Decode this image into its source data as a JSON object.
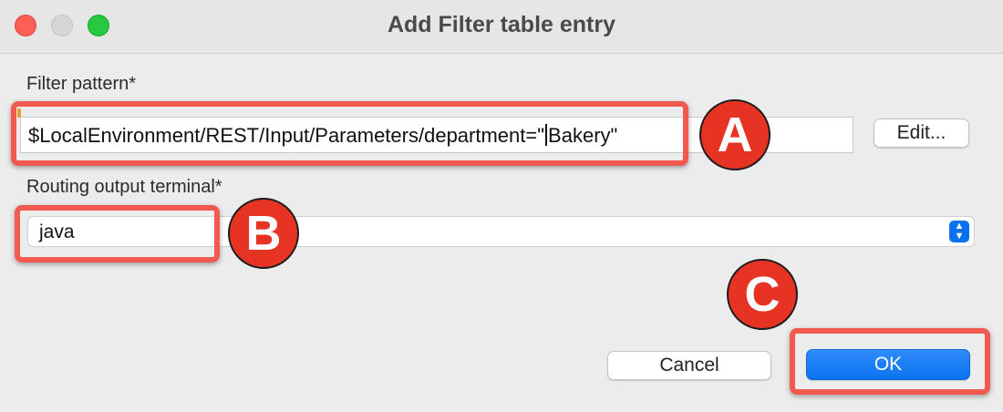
{
  "window": {
    "title": "Add Filter table entry"
  },
  "filter_pattern": {
    "label": "Filter pattern*",
    "value_before_caret": "$LocalEnvironment/REST/Input/Parameters/department=\"",
    "value_after_caret": "Bakery\"",
    "edit_button_label": "Edit..."
  },
  "routing_output_terminal": {
    "label": "Routing output terminal*",
    "selected_value": "java"
  },
  "buttons": {
    "cancel_label": "Cancel",
    "ok_label": "OK"
  },
  "annotations": {
    "a_label": "A",
    "b_label": "B",
    "c_label": "C",
    "color": "#e63323"
  }
}
